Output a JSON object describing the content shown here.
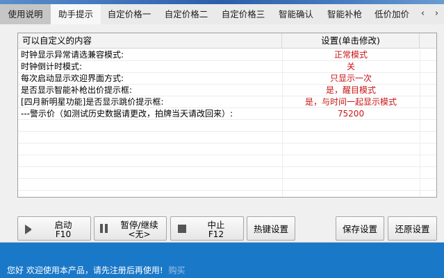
{
  "tabs": [
    {
      "label": "使用说明"
    },
    {
      "label": "助手提示"
    },
    {
      "label": "自定价格一"
    },
    {
      "label": "自定价格二"
    },
    {
      "label": "自定价格三"
    },
    {
      "label": "智能确认"
    },
    {
      "label": "智能补枪"
    },
    {
      "label": "低价加价"
    }
  ],
  "tab_scroll": {
    "left": "‹",
    "right": "›"
  },
  "settings_list": {
    "col_name": "可以自定义的内容",
    "col_value": "设置(单击修改)",
    "rows": [
      {
        "name": "时钟显示异常请选兼容模式:",
        "value": "正常模式"
      },
      {
        "name": "时钟倒计时模式:",
        "value": "关"
      },
      {
        "name": "每次启动显示欢迎界面方式:",
        "value": "只显示一次"
      },
      {
        "name": "是否显示智能补枪出价提示框:",
        "value": "是，醒目模式"
      },
      {
        "name": "[四月新明星功能]是否显示跳价提示框:",
        "value": "是，与时间一起显示模式"
      },
      {
        "name": "---警示价（如测试历史数据请更改，拍牌当天请改回来）:",
        "value": "75200"
      }
    ]
  },
  "buttons": {
    "start": {
      "label": "启动",
      "key": "F10"
    },
    "pause": {
      "label": "暂停/继续",
      "key": "<无>"
    },
    "stop": {
      "label": "中止",
      "key": "F12"
    },
    "hotkey": {
      "label": "热键设置"
    },
    "save": {
      "label": "保存设置"
    },
    "restore": {
      "label": "还原设置"
    }
  },
  "status": {
    "message": "您好 欢迎使用本产品，请先注册后再使用!",
    "buy_link": "购买"
  },
  "colors": {
    "value_text": "#c81414",
    "status_bg": "#1a78c8"
  }
}
